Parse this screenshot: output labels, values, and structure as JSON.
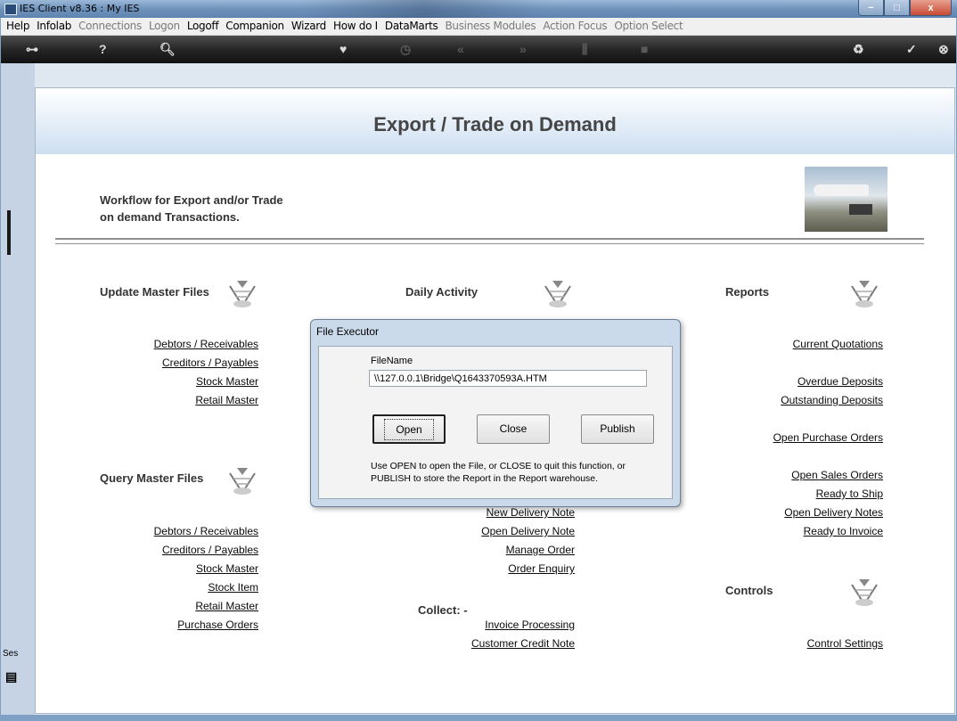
{
  "window": {
    "title": "IES Client v8.36 : My IES",
    "buttons": {
      "minimize": "−",
      "maximize": "□",
      "close": "x"
    }
  },
  "menu": [
    {
      "label": "Help",
      "enabled": true
    },
    {
      "label": "Infolab",
      "enabled": true
    },
    {
      "label": "Connections",
      "enabled": false
    },
    {
      "label": "Logon",
      "enabled": false
    },
    {
      "label": "Logoff",
      "enabled": true
    },
    {
      "label": "Companion",
      "enabled": true
    },
    {
      "label": "Wizard",
      "enabled": true
    },
    {
      "label": "How do I",
      "enabled": true
    },
    {
      "label": "DataMarts",
      "enabled": true
    },
    {
      "label": "Business Modules",
      "enabled": false
    },
    {
      "label": "Action Focus",
      "enabled": false
    },
    {
      "label": "Option Select",
      "enabled": false
    }
  ],
  "toolbar": {
    "icons": [
      {
        "name": "key-icon",
        "glyph": "⊶",
        "enabled": true
      },
      {
        "name": "help-icon",
        "glyph": "?",
        "enabled": true
      },
      {
        "name": "search-icon",
        "glyph": "🔍︎",
        "enabled": true
      },
      {
        "name": "heart-icon",
        "glyph": "♥",
        "enabled": true
      },
      {
        "name": "clock-icon",
        "glyph": "◷",
        "enabled": false
      },
      {
        "name": "back-icon",
        "glyph": "«",
        "enabled": false
      },
      {
        "name": "forward-icon",
        "glyph": "»",
        "enabled": false
      },
      {
        "name": "tools-icon",
        "glyph": "⫼",
        "enabled": false
      },
      {
        "name": "stop-icon",
        "glyph": "■",
        "enabled": false
      },
      {
        "name": "recycle-icon",
        "glyph": "♻",
        "enabled": true
      },
      {
        "name": "check-icon",
        "glyph": "✓",
        "enabled": true
      },
      {
        "name": "close-icon",
        "glyph": "⊗",
        "enabled": true
      }
    ]
  },
  "sidebar": {
    "session_label": "Ses"
  },
  "page": {
    "title": "Export / Trade on Demand",
    "intro_line1": "Workflow for Export and/or Trade",
    "intro_line2": "on demand Transactions."
  },
  "sections": {
    "update_master": {
      "heading": "Update Master Files",
      "links": [
        "Debtors / Receivables",
        "Creditors / Payables",
        "Stock Master",
        "Retail Master"
      ]
    },
    "query_master": {
      "heading": "Query Master Files",
      "links": [
        "Debtors / Receivables",
        "Creditors / Payables",
        "Stock Master",
        "Stock Item",
        "Retail Master",
        "Purchase Orders"
      ]
    },
    "daily_activity": {
      "heading": "Daily Activity",
      "links": [
        "New Delivery Note",
        "Open Delivery Note",
        "Manage Order",
        "Order Enquiry"
      ],
      "collect_heading": "Collect: -",
      "collect_links": [
        "Invoice Processing",
        "Customer Credit Note"
      ]
    },
    "reports": {
      "heading": "Reports",
      "links": [
        "Current Quotations",
        "Overdue Deposits",
        "Outstanding Deposits",
        "Open Purchase Orders",
        "Open Sales Orders",
        "Ready to Ship",
        "Open Delivery Notes",
        "Ready to Invoice"
      ]
    },
    "controls": {
      "heading": "Controls",
      "links": [
        "Control Settings"
      ]
    }
  },
  "dialog": {
    "title": "File Executor",
    "field_label": "FileName",
    "field_value": "\\\\127.0.0.1\\Bridge\\Q1643370593A.HTM",
    "open_label": "Open",
    "close_label": "Close",
    "publish_label": "Publish",
    "help_line1": "Use OPEN to open the File, or CLOSE to quit this function, or",
    "help_line2": "PUBLISH to store the Report in the Report warehouse."
  }
}
